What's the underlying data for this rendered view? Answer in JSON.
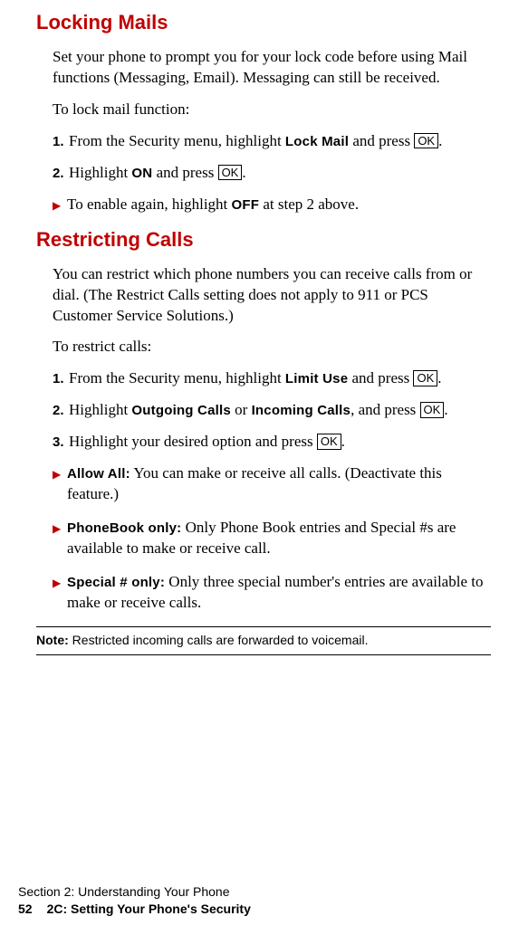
{
  "sections": {
    "lockingMails": {
      "heading": "Locking Mails",
      "intro": "Set your phone to prompt you for your lock code before using Mail functions (Messaging, Email). Messaging can still be received.",
      "howTo": "To lock mail function:",
      "steps": [
        {
          "num": "1.",
          "pre": "From the Security menu, highlight ",
          "bold": "Lock Mail",
          "mid": " and press ",
          "key": "OK",
          "post": "."
        },
        {
          "num": "2.",
          "pre": "Highlight ",
          "bold": "ON",
          "mid": " and press ",
          "key": "OK",
          "post": "."
        }
      ],
      "bullet": {
        "pre": "To enable again, highlight ",
        "bold": "OFF",
        "post": " at step 2 above."
      }
    },
    "restrictingCalls": {
      "heading": "Restricting Calls",
      "intro": "You can restrict which phone numbers you can receive calls from or dial. (The Restrict Calls setting does not apply to 911 or PCS Customer Service Solutions.)",
      "howTo": "To restrict calls:",
      "step1": {
        "num": "1.",
        "pre": "From the Security menu, highlight ",
        "bold": "Limit Use",
        "mid": " and press ",
        "key": "OK",
        "post": "."
      },
      "step2": {
        "num": "2.",
        "pre": "Highlight ",
        "bold1": "Outgoing Calls",
        "or": " or ",
        "bold2": "Incoming Calls",
        "mid": ", and press ",
        "key": "OK",
        "post": "."
      },
      "step3": {
        "num": "3.",
        "pre": "Highlight your desired option and press ",
        "key": "OK",
        "post": "."
      },
      "bullets": [
        {
          "label": "Allow All:",
          "text": " You can make or receive all calls. (Deactivate this feature.)"
        },
        {
          "label": "PhoneBook only:",
          "text": " Only Phone Book entries and Special #s are available to make or receive call."
        },
        {
          "label": "Special # only:",
          "text": " Only three special number's entries are available to make or receive calls."
        }
      ],
      "noteLabel": "Note: ",
      "noteText": "Restricted incoming calls are forwarded to voicemail."
    }
  },
  "footer": {
    "line1": "Section 2: Understanding Your Phone",
    "pageNum": "52",
    "line2": "2C: Setting Your Phone's Security"
  },
  "marks": {
    "triangle": "▶"
  }
}
